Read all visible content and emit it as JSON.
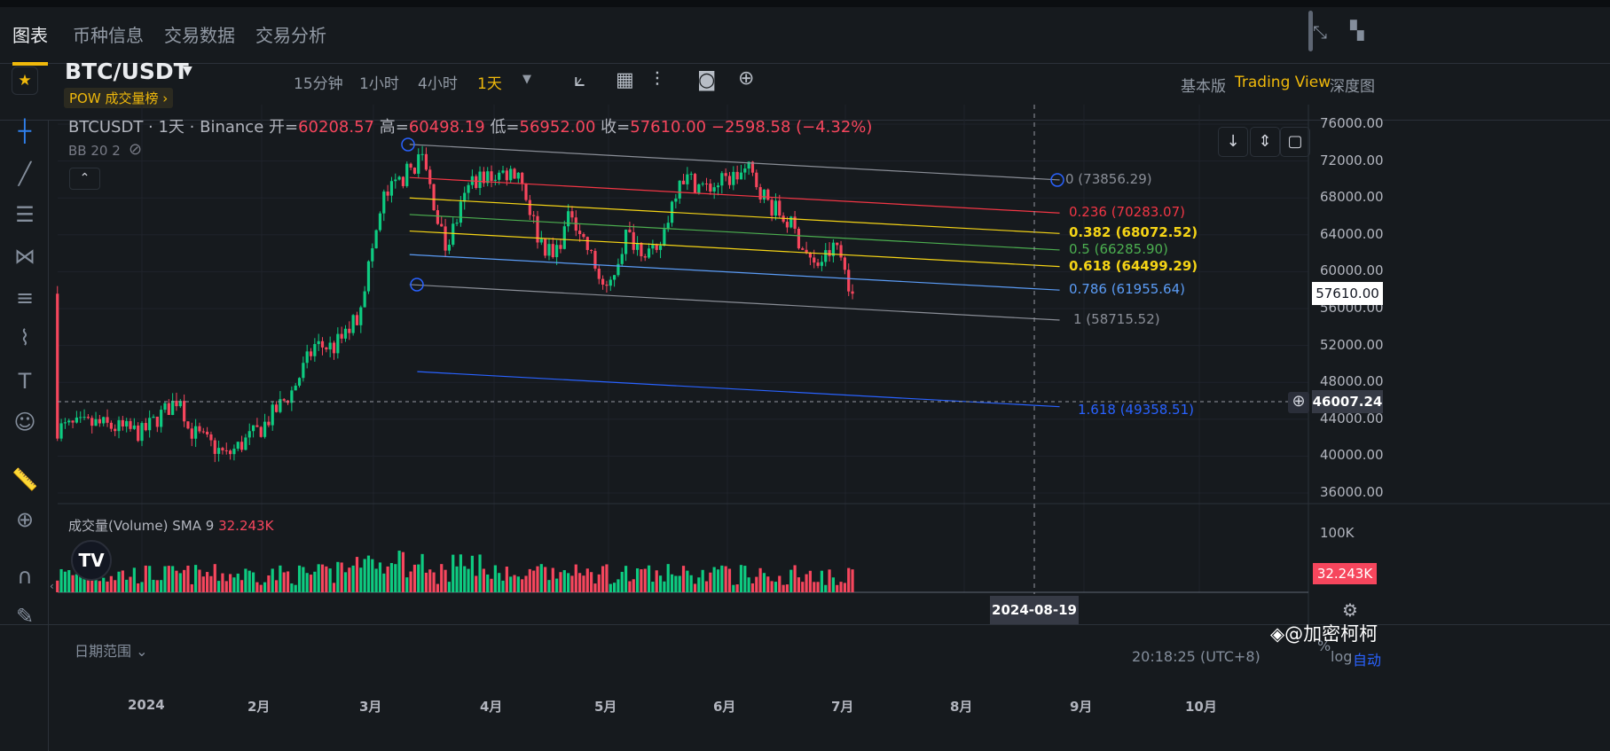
{
  "nav": {
    "tabs": [
      "图表",
      "币种信息",
      "交易数据",
      "交易分析"
    ]
  },
  "header": {
    "symbol": "BTC/USDT",
    "badge": "POW  成交量榜 ›",
    "timeframes": [
      "15分钟",
      "1小时",
      "4小时",
      "1天"
    ],
    "active_tf": "1天",
    "views": [
      "基本版",
      "Trading View",
      "深度图"
    ]
  },
  "legend": {
    "title": "BTCUSDT · 1天 · Binance",
    "o_label": "开=",
    "o": "60208.57",
    "h_label": "高=",
    "h": "60498.19",
    "l_label": "低=",
    "l": "56952.00",
    "c_label": "收=",
    "c": "57610.00",
    "change": "−2598.58 (−4.32%)",
    "bb": "BB 20 2"
  },
  "price_axis": [
    "76000.00",
    "72000.00",
    "68000.00",
    "64000.00",
    "60000.00",
    "56000.00",
    "52000.00",
    "48000.00",
    "44000.00",
    "40000.00",
    "36000.00"
  ],
  "last_price": "57610.00",
  "crosshair_price": "46007.24",
  "crosshair_date": "2024-08-19",
  "volume": {
    "label": "成交量(Volume) SMA 9",
    "value": "32.243K",
    "axis": "100K"
  },
  "time_axis": [
    "2024",
    "2月",
    "3月",
    "4月",
    "5月",
    "6月",
    "7月",
    "8月",
    "9月",
    "10月"
  ],
  "footer": {
    "range": "日期范围 ⌄",
    "clock": "20:18:25 (UTC+8)",
    "pct": "%",
    "log": "log",
    "auto": "自动",
    "watermark": "@加密柯柯"
  },
  "colors": {
    "up": "#0ecb81",
    "down": "#f6465d",
    "accent": "#f0b90b"
  },
  "chart_data": {
    "type": "candlestick",
    "x_unit": "days from 2024-01-01",
    "close_anchors": [
      [
        -22,
        43000
      ],
      [
        -12,
        43500
      ],
      [
        0,
        42500
      ],
      [
        10,
        46500
      ],
      [
        12,
        43000
      ],
      [
        22,
        40000
      ],
      [
        31,
        43000
      ],
      [
        39,
        47000
      ],
      [
        45,
        52000
      ],
      [
        50,
        51800
      ],
      [
        56,
        55000
      ],
      [
        63,
        68000
      ],
      [
        73,
        72500
      ],
      [
        79,
        62500
      ],
      [
        86,
        70000
      ],
      [
        98,
        71000
      ],
      [
        103,
        64000
      ],
      [
        107,
        61500
      ],
      [
        112,
        66500
      ],
      [
        121,
        57500
      ],
      [
        126,
        64000
      ],
      [
        134,
        61500
      ],
      [
        140,
        70500
      ],
      [
        147,
        69000
      ],
      [
        158,
        71000
      ],
      [
        163,
        67500
      ],
      [
        169,
        65000
      ],
      [
        175,
        60500
      ],
      [
        181,
        62800
      ],
      [
        185,
        57610
      ]
    ],
    "ylim": [
      36000,
      76000
    ],
    "fib_channel": {
      "start": [
        69,
        73800
      ],
      "end": [
        238,
        69950
      ],
      "range": 15200,
      "levels": [
        {
          "level": 0,
          "label": "0 (73856.29)",
          "color": "#8a8e97"
        },
        {
          "level": 0.236,
          "label": "0.236 (70283.07)",
          "color": "#f23645"
        },
        {
          "level": 0.382,
          "label": "0.382 (68072.52)",
          "color": "#f5d416"
        },
        {
          "level": 0.5,
          "label": "0.5 (66285.90)",
          "color": "#4caf50"
        },
        {
          "level": 0.618,
          "label": "0.618 (64499.29)",
          "color": "#f5d416"
        },
        {
          "level": 0.786,
          "label": "0.786 (61955.64)",
          "color": "#5b9cf6"
        },
        {
          "level": 1,
          "label": "1 (58715.52)",
          "color": "#8a8e97"
        },
        {
          "level": 1.618,
          "label": "1.618 (49358.51)",
          "color": "#2962ff"
        }
      ]
    }
  }
}
